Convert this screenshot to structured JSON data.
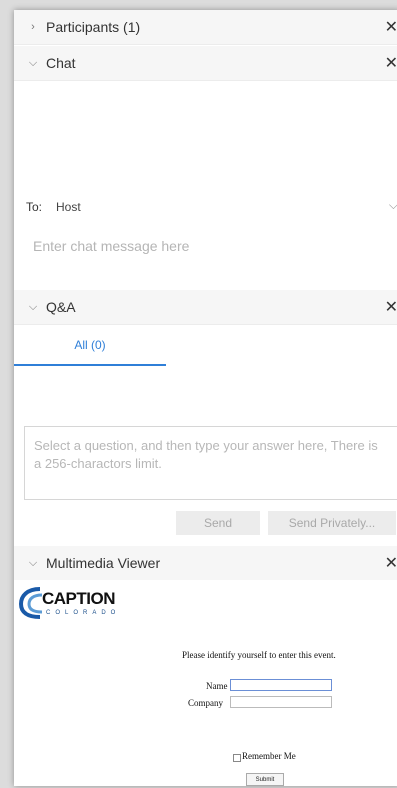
{
  "participants": {
    "title": "Participants (1)"
  },
  "chat": {
    "title": "Chat",
    "to_label": "To:",
    "to_value": "Host",
    "input_placeholder": "Enter chat message here"
  },
  "qa": {
    "title": "Q&A",
    "tab_all": "All (0)",
    "answer_placeholder": "Select a question, and then type your answer here, There is a 256-charactors limit.",
    "send_label": "Send",
    "send_privately_label": "Send Privately..."
  },
  "multimedia": {
    "title": "Multimedia Viewer",
    "logo_word": "CAPTION",
    "logo_sub": "COLORADO",
    "prompt": "Please identify yourself to enter this event.",
    "name_label": "Name",
    "company_label": "Company",
    "remember_label": "Remember Me",
    "submit_label": "Submit"
  },
  "icons": {
    "close": "close-icon",
    "chevron_right": "chevron-right-icon",
    "chevron_down": "chevron-down-icon"
  },
  "colors": {
    "accent": "#2f7fd8",
    "header_bg": "#f6f6f6"
  }
}
